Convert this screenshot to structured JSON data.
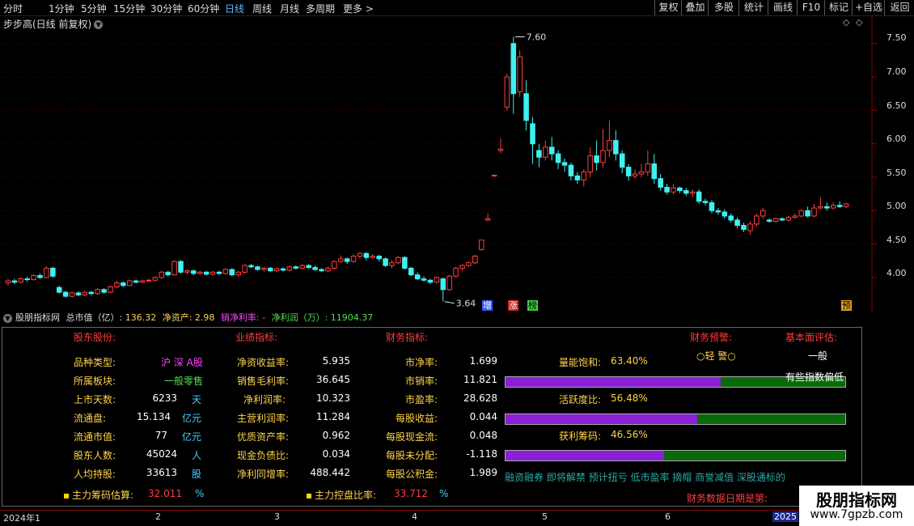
{
  "topbar": {
    "periods": [
      "分时",
      "1分钟",
      "5分钟",
      "15分钟",
      "30分钟",
      "60分钟",
      "日线",
      "周线",
      "月线",
      "多周期",
      "更多 >"
    ],
    "active_period": "日线",
    "right_buttons": [
      "复权",
      "叠加",
      "多股",
      "统计",
      "画线",
      "F10",
      "标记",
      "+自选",
      "返回"
    ]
  },
  "chart": {
    "title": "步步高(日线 前复权)",
    "title_icon": "chevron-down-icon",
    "price_labels": [
      "7.50",
      "7.00",
      "6.50",
      "6.00",
      "5.50",
      "5.00",
      "4.50",
      "4.00"
    ],
    "high_marker": "7.60",
    "low_marker": "3.64",
    "badges": [
      "增",
      "涨",
      "榜",
      "预"
    ]
  },
  "chart_data": {
    "type": "candlestick",
    "title": "步步高(日线 前复权)",
    "ylim": [
      3.6,
      7.8
    ],
    "y_ticks": [
      4.0,
      4.5,
      5.0,
      5.5,
      6.0,
      6.5,
      7.0,
      7.5
    ],
    "x_ticks": [
      "2024年1",
      "2",
      "3",
      "4",
      "5",
      "6",
      "2025"
    ],
    "high": 7.6,
    "low": 3.64,
    "candles": [
      [
        3.92,
        3.95,
        3.88,
        3.98
      ],
      [
        3.95,
        3.93,
        3.9,
        3.98
      ],
      [
        3.93,
        3.98,
        3.91,
        4.0
      ],
      [
        3.98,
        3.97,
        3.94,
        4.01
      ],
      [
        3.97,
        4.03,
        3.95,
        4.05
      ],
      [
        4.03,
        4.0,
        3.98,
        4.06
      ],
      [
        4.0,
        4.14,
        3.99,
        4.17
      ],
      [
        4.14,
        4.02,
        4.0,
        4.16
      ],
      [
        3.85,
        3.78,
        3.76,
        3.88
      ],
      [
        3.78,
        3.72,
        3.7,
        3.8
      ],
      [
        3.72,
        3.77,
        3.7,
        3.79
      ],
      [
        3.77,
        3.74,
        3.72,
        3.79
      ],
      [
        3.74,
        3.78,
        3.72,
        3.8
      ],
      [
        3.78,
        3.76,
        3.74,
        3.8
      ],
      [
        3.76,
        3.82,
        3.74,
        3.84
      ],
      [
        3.82,
        3.78,
        3.76,
        3.84
      ],
      [
        3.78,
        3.86,
        3.77,
        3.88
      ],
      [
        3.86,
        3.92,
        3.84,
        3.95
      ],
      [
        3.92,
        3.88,
        3.86,
        3.94
      ],
      [
        3.88,
        3.95,
        3.87,
        3.97
      ],
      [
        3.95,
        3.93,
        3.91,
        3.97
      ],
      [
        3.93,
        3.95,
        3.92,
        3.97
      ],
      [
        3.95,
        3.96,
        3.93,
        3.98
      ],
      [
        3.96,
        4.0,
        3.94,
        4.02
      ],
      [
        4.0,
        4.08,
        3.98,
        4.1
      ],
      [
        4.08,
        4.04,
        4.02,
        4.1
      ],
      [
        4.04,
        4.24,
        4.03,
        4.26
      ],
      [
        4.24,
        4.08,
        4.06,
        4.26
      ],
      [
        4.08,
        4.1,
        4.05,
        4.12
      ],
      [
        4.1,
        4.06,
        4.04,
        4.12
      ],
      [
        4.06,
        4.08,
        4.04,
        4.1
      ],
      [
        4.08,
        4.05,
        4.03,
        4.1
      ],
      [
        4.05,
        4.08,
        4.03,
        4.1
      ],
      [
        4.08,
        4.06,
        4.04,
        4.1
      ],
      [
        4.06,
        4.12,
        4.04,
        4.14
      ],
      [
        4.12,
        4.04,
        4.02,
        4.14
      ],
      [
        4.04,
        4.08,
        4.01,
        4.1
      ],
      [
        4.08,
        4.18,
        4.06,
        4.2
      ],
      [
        4.18,
        4.16,
        4.14,
        4.2
      ],
      [
        4.16,
        4.12,
        4.1,
        4.18
      ],
      [
        4.12,
        4.14,
        4.09,
        4.16
      ],
      [
        4.14,
        4.1,
        4.08,
        4.16
      ],
      [
        4.1,
        4.13,
        4.08,
        4.15
      ],
      [
        4.13,
        4.11,
        4.09,
        4.15
      ],
      [
        4.11,
        4.16,
        4.09,
        4.18
      ],
      [
        4.16,
        4.14,
        4.12,
        4.18
      ],
      [
        4.14,
        4.18,
        4.12,
        4.2
      ],
      [
        4.18,
        4.15,
        4.13,
        4.2
      ],
      [
        4.15,
        4.12,
        4.1,
        4.18
      ],
      [
        4.12,
        4.1,
        4.08,
        4.14
      ],
      [
        4.1,
        4.14,
        4.08,
        4.16
      ],
      [
        4.14,
        4.24,
        4.12,
        4.26
      ],
      [
        4.24,
        4.28,
        4.22,
        4.33
      ],
      [
        4.28,
        4.24,
        4.2,
        4.3
      ],
      [
        4.24,
        4.32,
        4.22,
        4.35
      ],
      [
        4.32,
        4.36,
        4.28,
        4.38
      ],
      [
        4.36,
        4.3,
        4.26,
        4.38
      ],
      [
        4.3,
        4.32,
        4.28,
        4.35
      ],
      [
        4.32,
        4.28,
        4.24,
        4.34
      ],
      [
        4.28,
        4.18,
        4.16,
        4.3
      ],
      [
        4.18,
        4.22,
        4.14,
        4.26
      ],
      [
        4.22,
        4.3,
        4.2,
        4.32
      ],
      [
        4.3,
        4.14,
        4.12,
        4.32
      ],
      [
        4.14,
        4.04,
        4.02,
        4.16
      ],
      [
        4.04,
        3.98,
        3.96,
        4.08
      ],
      [
        3.98,
        3.96,
        3.94,
        4.02
      ],
      [
        3.96,
        3.93,
        3.9,
        3.98
      ],
      [
        3.93,
        4.0,
        3.91,
        4.02
      ],
      [
        3.98,
        3.82,
        3.64,
        4.0
      ],
      [
        3.82,
        4.02,
        3.8,
        4.04
      ],
      [
        4.02,
        4.14,
        4.0,
        4.16
      ],
      [
        4.14,
        4.18,
        4.1,
        4.2
      ],
      [
        4.18,
        4.22,
        4.16,
        4.24
      ],
      [
        4.22,
        4.32,
        4.2,
        4.34
      ],
      [
        4.42,
        4.56,
        4.4,
        4.56
      ],
      [
        4.86,
        4.88,
        4.84,
        4.96
      ],
      [
        5.52,
        5.53,
        5.51,
        5.54
      ],
      [
        5.9,
        5.92,
        5.86,
        6.08
      ],
      [
        6.55,
        7.0,
        6.5,
        7.05
      ],
      [
        7.5,
        6.75,
        6.45,
        7.6
      ],
      [
        6.78,
        7.3,
        6.7,
        7.4
      ],
      [
        6.75,
        6.35,
        6.2,
        6.95
      ],
      [
        6.3,
        6.0,
        5.7,
        6.4
      ],
      [
        5.9,
        5.8,
        5.65,
        6.0
      ],
      [
        5.8,
        5.95,
        5.75,
        6.05
      ],
      [
        5.95,
        5.85,
        5.75,
        6.1
      ],
      [
        5.85,
        5.72,
        5.62,
        5.9
      ],
      [
        5.72,
        5.68,
        5.58,
        5.78
      ],
      [
        5.68,
        5.52,
        5.45,
        5.72
      ],
      [
        5.52,
        5.46,
        5.4,
        5.58
      ],
      [
        5.46,
        5.58,
        5.36,
        5.62
      ],
      [
        5.58,
        5.82,
        5.5,
        5.95
      ],
      [
        5.82,
        5.72,
        5.6,
        6.05
      ],
      [
        5.72,
        5.9,
        5.65,
        6.22
      ],
      [
        5.9,
        6.05,
        5.8,
        6.35
      ],
      [
        6.05,
        5.85,
        5.75,
        6.2
      ],
      [
        5.85,
        5.65,
        5.56,
        5.9
      ],
      [
        5.65,
        5.52,
        5.45,
        5.7
      ],
      [
        5.52,
        5.55,
        5.48,
        5.62
      ],
      [
        5.55,
        5.58,
        5.5,
        5.7
      ],
      [
        5.58,
        5.7,
        5.52,
        5.9
      ],
      [
        5.7,
        5.48,
        5.4,
        5.85
      ],
      [
        5.48,
        5.35,
        5.3,
        5.55
      ],
      [
        5.35,
        5.28,
        5.24,
        5.4
      ],
      [
        5.28,
        5.34,
        5.24,
        5.4
      ],
      [
        5.34,
        5.3,
        5.26,
        5.36
      ],
      [
        5.3,
        5.26,
        5.22,
        5.34
      ],
      [
        5.26,
        5.28,
        5.2,
        5.32
      ],
      [
        5.28,
        5.14,
        5.1,
        5.32
      ],
      [
        5.14,
        5.12,
        5.08,
        5.18
      ],
      [
        5.12,
        5.0,
        4.96,
        5.16
      ],
      [
        5.0,
        4.98,
        4.94,
        5.04
      ],
      [
        4.98,
        4.92,
        4.88,
        5.02
      ],
      [
        4.92,
        4.86,
        4.82,
        4.96
      ],
      [
        4.86,
        4.78,
        4.74,
        4.9
      ],
      [
        4.78,
        4.72,
        4.68,
        4.82
      ],
      [
        4.7,
        4.8,
        4.64,
        4.84
      ],
      [
        4.8,
        4.92,
        4.76,
        4.96
      ],
      [
        4.92,
        5.0,
        4.88,
        5.04
      ],
      [
        4.86,
        4.84,
        4.82,
        4.88
      ],
      [
        4.84,
        4.88,
        4.82,
        4.9
      ],
      [
        4.88,
        4.86,
        4.84,
        4.9
      ],
      [
        4.86,
        4.9,
        4.84,
        4.92
      ],
      [
        4.9,
        4.92,
        4.88,
        4.96
      ],
      [
        4.92,
        5.0,
        4.9,
        5.02
      ],
      [
        5.0,
        4.92,
        4.9,
        5.06
      ],
      [
        4.92,
        5.04,
        4.9,
        5.1
      ],
      [
        5.04,
        5.06,
        5.02,
        5.2
      ],
      [
        5.06,
        5.04,
        5.0,
        5.12
      ],
      [
        5.04,
        5.08,
        5.02,
        5.12
      ],
      [
        5.08,
        5.06,
        5.04,
        5.14
      ],
      [
        5.06,
        5.1,
        5.04,
        5.12
      ]
    ]
  },
  "summary_bar": {
    "title": "股朋指标网",
    "market_cap_label": "总市值（亿）: ",
    "market_cap": "136.32",
    "net_assets_label": "净资产: ",
    "net_assets": "2.98",
    "net_margin_label": "销净利率: ",
    "net_margin": "-",
    "net_profit_label": "净利润（万）: ",
    "net_profit": "11904.37"
  },
  "panel": {
    "headers": {
      "shareholder": "股东股份:",
      "performance": "业绩指标:",
      "financial": "财务指标:",
      "warning": "财务预警:",
      "fundamental": "基本面评估:"
    },
    "col1": [
      {
        "label": "品种类型:",
        "value": "沪 深 A股",
        "unit": ""
      },
      {
        "label": "所属板块:",
        "value": "一般零售",
        "unit": ""
      },
      {
        "label": "上市天数:",
        "value": "6233",
        "unit": "天"
      },
      {
        "label": "流通盘:",
        "value": "15.134",
        "unit": "亿元"
      },
      {
        "label": "流通市值:",
        "value": "77",
        "unit": "亿元"
      },
      {
        "label": "股东人数:",
        "value": "45024",
        "unit": "人"
      },
      {
        "label": "人均持股:",
        "value": "33613",
        "unit": "股"
      }
    ],
    "col2": [
      {
        "label": "净资收益率:",
        "value": "5.935"
      },
      {
        "label": "销售毛利率:",
        "value": "36.645"
      },
      {
        "label": "净利润率:",
        "value": "10.323"
      },
      {
        "label": "主营利润率:",
        "value": "11.284"
      },
      {
        "label": "优质资产率:",
        "value": "0.962"
      },
      {
        "label": "现金负债比:",
        "value": "0.034"
      },
      {
        "label": "净利同增率:",
        "value": "488.442"
      }
    ],
    "col3": [
      {
        "label": "市净率:",
        "value": "1.699"
      },
      {
        "label": "市销率:",
        "value": "11.821"
      },
      {
        "label": "市盈率:",
        "value": "28.628"
      },
      {
        "label": "每股收益:",
        "value": "0.044"
      },
      {
        "label": "每股现金流:",
        "value": "0.048"
      },
      {
        "label": "每股未分配:",
        "value": "-1.118"
      },
      {
        "label": "每股公积金:",
        "value": "1.989"
      }
    ],
    "meters": [
      {
        "label": "量能饱和:",
        "value": "63.40%",
        "fraction": 0.634
      },
      {
        "label": "活跃度比:",
        "value": "56.48%",
        "fraction": 0.5648
      },
      {
        "label": "获利筹码:",
        "value": "46.56%",
        "fraction": 0.4656
      }
    ],
    "warning_value": "○轻 警○",
    "fundamental_value": "一般",
    "fundamental_note": "有些指数偏低",
    "tags_line": "融资融券  即将解禁  预计扭亏  低市盈率  摘帽  商誉减值  深股通标的",
    "main_chip_label": "主力筹码估算:",
    "main_chip_value": "32.011",
    "main_chip_unit": "%",
    "main_control_label": "主力控盘比率:",
    "main_control_value": "33.712",
    "main_control_unit": "%",
    "report_date_label": "财务数据日期是第:"
  },
  "x_axis": {
    "labels": [
      "2024年1",
      "2",
      "3",
      "4",
      "5",
      "6",
      "2025"
    ]
  },
  "watermark": {
    "title": "股朋指标网",
    "url": "www.7gpzb.com"
  },
  "colors": {
    "up": "#ff3d3d",
    "down": "#3ff0f0",
    "axis": "#8b0000",
    "label_yellow": "#ffd24a",
    "value_cyan": "#3fd0ff",
    "meter_fill": "#8a1fd6",
    "meter_bg": "#0a6a0a"
  }
}
